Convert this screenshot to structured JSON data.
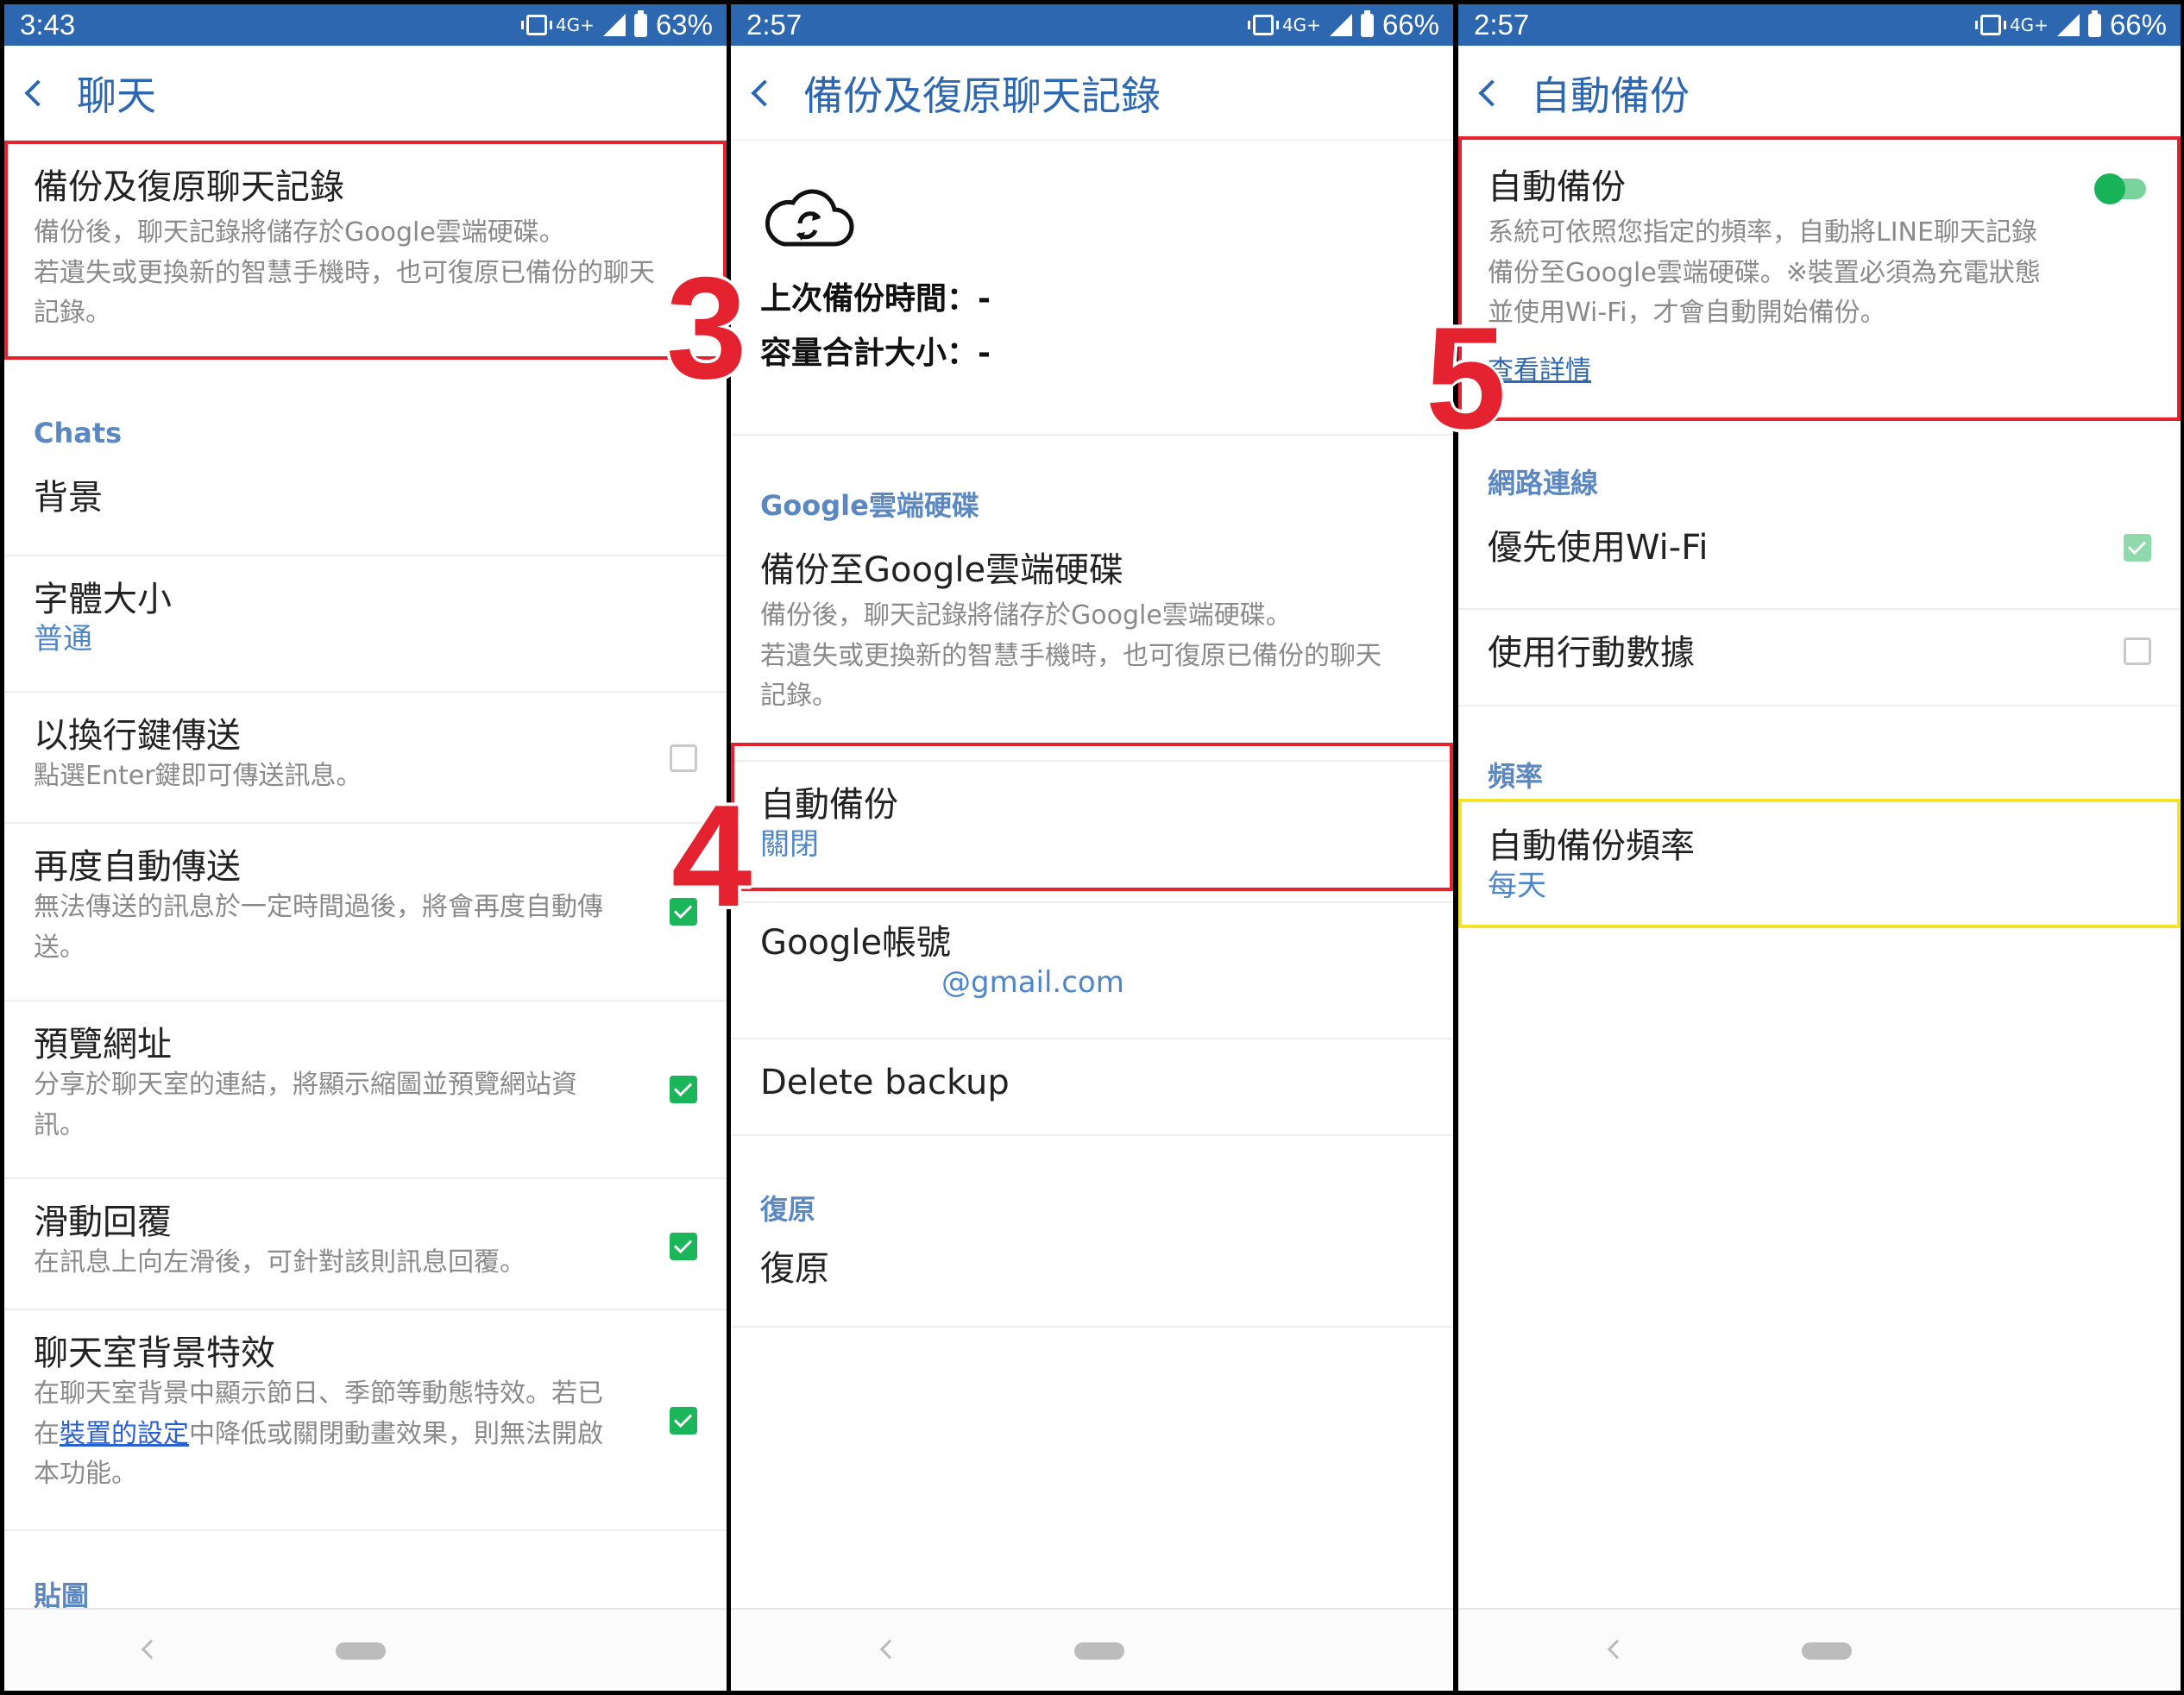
{
  "panel1": {
    "status": {
      "time": "3:43",
      "net": "4G+",
      "battery": "63%"
    },
    "appbar": {
      "title": "聊天"
    },
    "backup_item": {
      "title": "備份及復原聊天記錄",
      "desc_line1": "備份後，聊天記錄將儲存於Google雲端硬碟。",
      "desc_line2": "若遺失或更換新的智慧手機時，也可復原已備份的聊天",
      "desc_line3": "記錄。"
    },
    "section_chats": "Chats",
    "items": [
      {
        "title": "背景"
      },
      {
        "title": "字體大小",
        "value": "普通"
      },
      {
        "title": "以換行鍵傳送",
        "desc": "點選Enter鍵即可傳送訊息。",
        "checked": false
      },
      {
        "title": "再度自動傳送",
        "desc_line1": "無法傳送的訊息於一定時間過後，將會再度自動傳",
        "desc_line2": "送。",
        "checked": true
      },
      {
        "title": "預覽網址",
        "desc_line1": "分享於聊天室的連結，將顯示縮圖並預覽網站資",
        "desc_line2": "訊。",
        "checked": true
      },
      {
        "title": "滑動回覆",
        "desc": "在訊息上向左滑後，可針對該則訊息回覆。",
        "checked": true
      },
      {
        "title": "聊天室背景特效",
        "desc_line1": "在聊天室背景中顯示節日、季節等動態特效。若已",
        "desc_pre": "在",
        "desc_link": "裝置的設定",
        "desc_post": "中降低或關閉動畫效果，則無法開啟",
        "desc_line3": "本功能。",
        "checked": true
      }
    ],
    "section_stickers": "貼圖",
    "step_label": "3"
  },
  "panel2": {
    "status": {
      "time": "2:57",
      "net": "4G+",
      "battery": "66%"
    },
    "appbar": {
      "title": "備份及復原聊天記錄"
    },
    "last_backup": "上次備份時間：-",
    "total_size": "容量合計大小：-",
    "section_drive": "Google雲端硬碟",
    "backup_to_drive": {
      "title": "備份至Google雲端硬碟",
      "desc_line1": "備份後，聊天記錄將儲存於Google雲端硬碟。",
      "desc_line2": "若遺失或更換新的智慧手機時，也可復原已備份的聊天",
      "desc_line3": "記錄。"
    },
    "auto_backup": {
      "title": "自動備份",
      "value": "關閉"
    },
    "google_account": {
      "title": "Google帳號",
      "value": "@gmail.com"
    },
    "delete_backup": "Delete backup",
    "section_restore": "復原",
    "restore": "復原",
    "step_label": "4"
  },
  "panel3": {
    "status": {
      "time": "2:57",
      "net": "4G+",
      "battery": "66%"
    },
    "appbar": {
      "title": "自動備份"
    },
    "auto_backup": {
      "title": "自動備份",
      "desc_line1": "系統可依照您指定的頻率，自動將LINE聊天記錄",
      "desc_line2": "備份至Google雲端硬碟。※裝置必須為充電狀態",
      "desc_line3": "並使用Wi-Fi，才會自動開始備份。",
      "link": "查看詳情",
      "enabled": true
    },
    "section_network": "網路連線",
    "prefer_wifi": {
      "title": "優先使用Wi-Fi",
      "checked": true
    },
    "use_mobile_data": {
      "title": "使用行動數據",
      "checked": false
    },
    "section_frequency": "頻率",
    "frequency": {
      "title": "自動備份頻率",
      "value": "每天"
    },
    "step_label": "5"
  },
  "colors": {
    "status_bar": "#2c67b0",
    "accent": "#2c67b0",
    "highlight_red": "#e52330",
    "highlight_yellow": "#f4e52a",
    "checkbox_on": "#1bb55a"
  }
}
